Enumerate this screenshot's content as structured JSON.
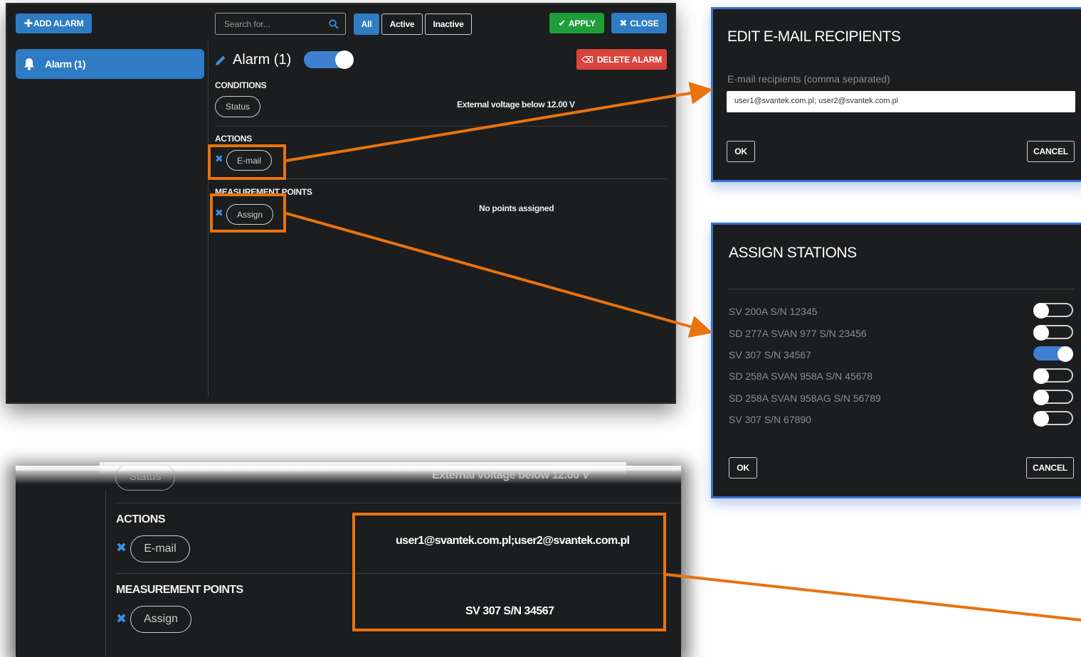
{
  "toolbar": {
    "add_alarm": "ADD ALARM",
    "search_placeholder": "Search for...",
    "filters": [
      "All",
      "Active",
      "Inactive"
    ],
    "apply": "APPLY",
    "close": "CLOSE"
  },
  "sidebar": {
    "alarm_item": "Alarm (1)"
  },
  "alarm": {
    "title": "Alarm (1)",
    "enabled": true,
    "delete": "DELETE ALARM",
    "conditions_label": "CONDITIONS",
    "condition_pill": "Status",
    "condition_text": "External voltage below 12.00 V",
    "actions_label": "ACTIONS",
    "action_pill": "E-mail",
    "measurement_label": "MEASUREMENT POINTS",
    "measurement_pill": "Assign",
    "no_points": "No points assigned"
  },
  "email_dialog": {
    "title": "EDIT E-MAIL RECIPIENTS",
    "field_label": "E-mail recipients (comma separated)",
    "field_value": "user1@svantek.com.pl; user2@svantek.com.pl",
    "ok": "OK",
    "cancel": "CANCEL"
  },
  "stations_dialog": {
    "title": "ASSIGN STATIONS",
    "stations": [
      {
        "label": "SV 200A S/N 12345",
        "on": false
      },
      {
        "label": "SD 277A SVAN 977 S/N 23456",
        "on": false
      },
      {
        "label": "SV 307 S/N 34567",
        "on": true
      },
      {
        "label": "SD 258A SVAN 958A S/N 45678",
        "on": false
      },
      {
        "label": "SD 258A SVAN 958AG S/N 56789",
        "on": false
      },
      {
        "label": "SV 307 S/N 67890",
        "on": false
      }
    ],
    "ok": "OK",
    "cancel": "CANCEL"
  },
  "result": {
    "condition_pill": "Status",
    "condition_text": "External voltage below 12.00 V",
    "actions_label": "ACTIONS",
    "action_pill": "E-mail",
    "measurement_label": "MEASUREMENT POINTS",
    "measurement_pill": "Assign",
    "emails": "user1@svantek.com.pl;user2@svantek.com.pl",
    "station": "SV 307 S/N 34567"
  },
  "colors": {
    "accent_blue": "#2f7bc4",
    "apply_green": "#1f9d3a",
    "delete_red": "#d9443d",
    "highlight_orange": "#e8730f",
    "panel_bg": "#1b1d1e"
  }
}
